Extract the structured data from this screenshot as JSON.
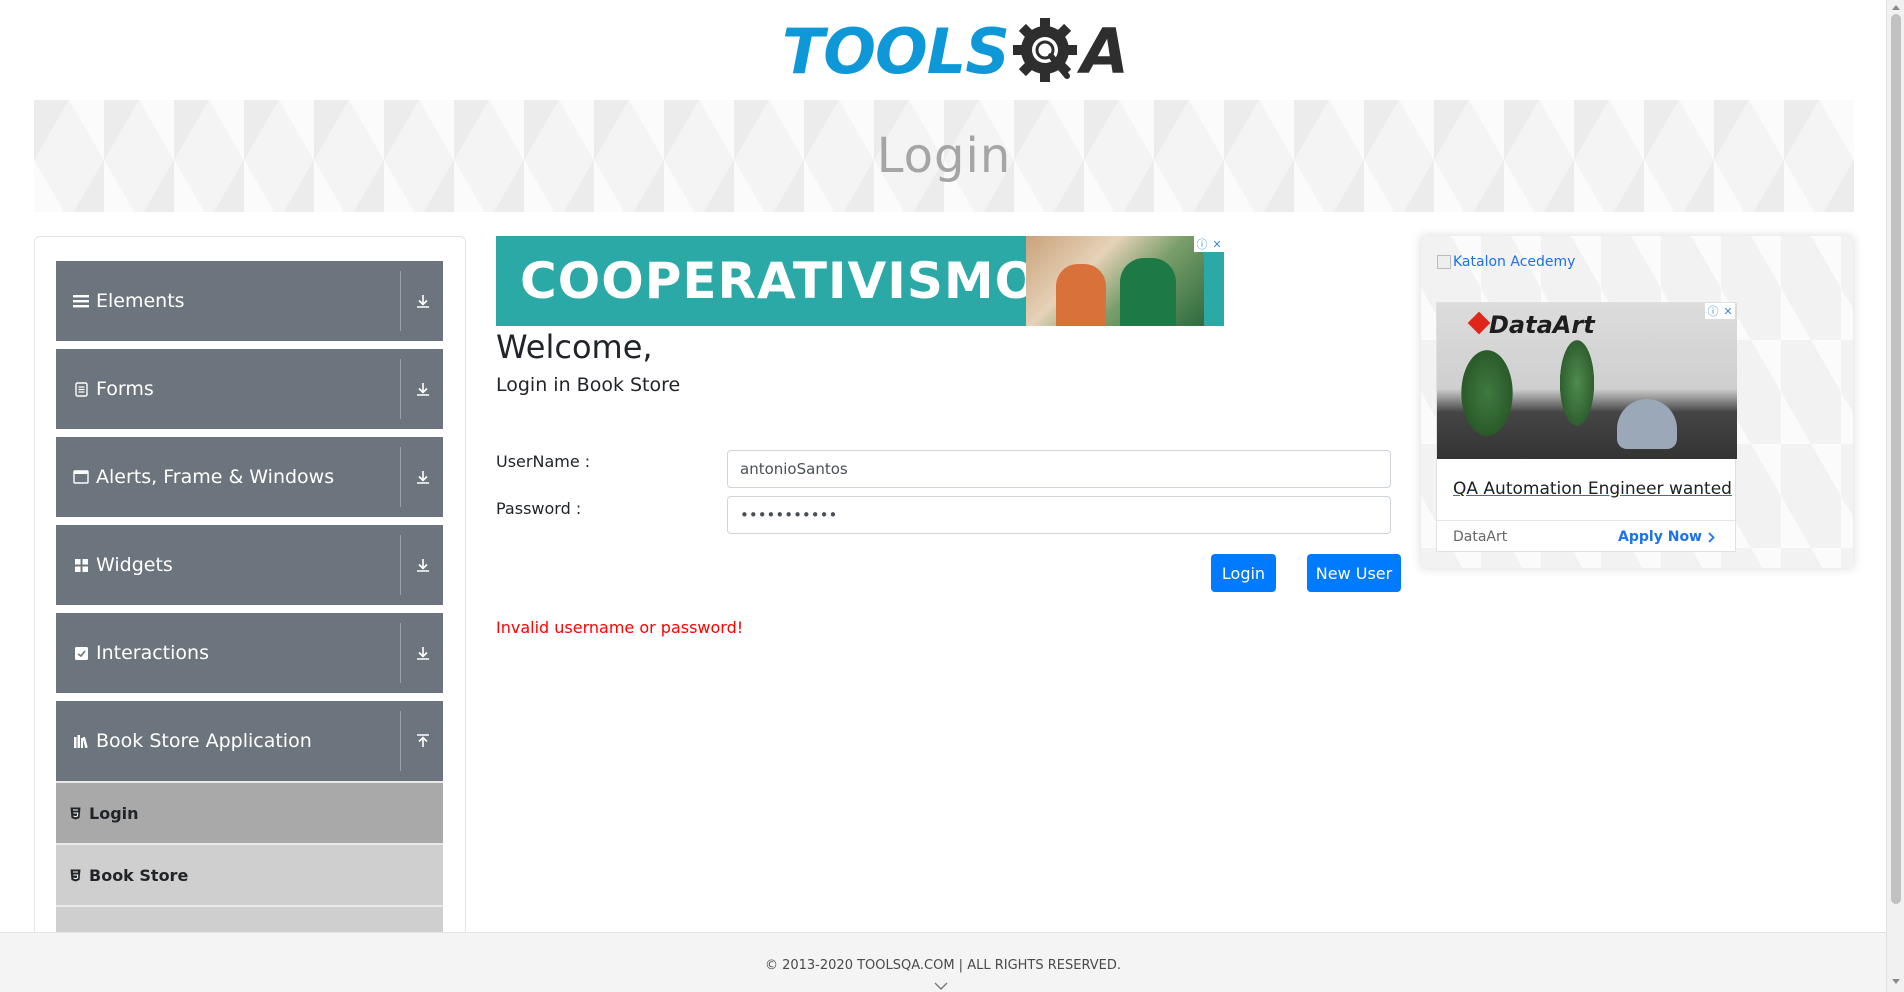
{
  "header": {
    "logo_part1": "TOOLS",
    "logo_part2": "A",
    "logo_colors": {
      "blue": "#0e98d8",
      "dark": "#2e2e2e"
    }
  },
  "banner": {
    "title": "Login"
  },
  "sidebar": {
    "groups": [
      {
        "label": "Elements",
        "icon": "hamburger-icon",
        "expanded": false
      },
      {
        "label": "Forms",
        "icon": "document-icon",
        "expanded": false
      },
      {
        "label": "Alerts, Frame & Windows",
        "icon": "window-icon",
        "expanded": false
      },
      {
        "label": "Widgets",
        "icon": "widgets-icon",
        "expanded": false
      },
      {
        "label": "Interactions",
        "icon": "interactions-icon",
        "expanded": false
      },
      {
        "label": "Book Store Application",
        "icon": "books-icon",
        "expanded": true
      }
    ],
    "book_store_items": [
      {
        "label": "Login",
        "icon": "html5-icon",
        "active": true
      },
      {
        "label": "Book Store",
        "icon": "html5-icon",
        "active": false
      }
    ],
    "colors": {
      "header_bg": "#6c757d",
      "item_bg": "#cfcfcf",
      "item_active_bg": "#a9a9a9"
    }
  },
  "main": {
    "ad_top": {
      "text": "COOPERATIVISMO",
      "bg": "#2aa9a6"
    },
    "welcome": "Welcome,",
    "subtitle": "Login in Book Store",
    "username_label": "UserName :",
    "username_value": "antonioSantos",
    "password_label": "Password :",
    "password_value": "antonioSant",
    "login_button": "Login",
    "new_user_button": "New User",
    "error_message": "Invalid username or password!",
    "button_color": "#007bff",
    "error_color": "#ff0000"
  },
  "right_ad": {
    "broken_image_alt": "Katalon Acedemy",
    "brand": "DataArt",
    "headline": "QA Automation Engineer wanted",
    "advertiser": "DataArt",
    "cta": "Apply Now"
  },
  "footer": {
    "text": "© 2013-2020 TOOLSQA.COM | ALL RIGHTS RESERVED."
  }
}
